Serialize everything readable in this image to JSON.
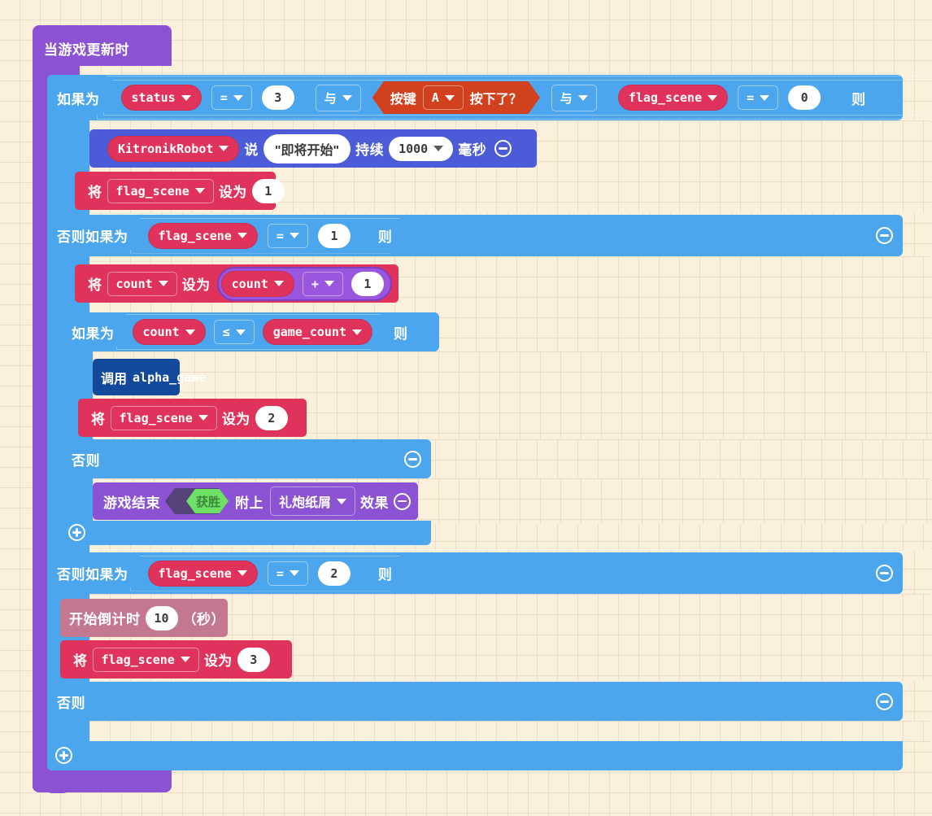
{
  "workspace": {
    "background_color": "#FBF0DC",
    "grid_color": "#C8B496"
  },
  "hat_block": {
    "label": "当游戏更新时",
    "color": "#8B52D4"
  },
  "blocks": {
    "if_keyword": "如果为",
    "else_if_keyword": "否则如果为",
    "else_keyword": "否则",
    "then_keyword": "则",
    "set_keyword": "将",
    "to_keyword": "设为",
    "control_color": "#4BA6EE",
    "variable_color": "#E0335B",
    "math_color": "#9B56E0",
    "input_color": "#D2411E",
    "robot_color": "#4C5CD8",
    "function_color": "#12499B",
    "game_color": "#8B52D4",
    "timer_color": "#C4788F"
  },
  "condition_1": {
    "var_a": "status",
    "op_a": "=",
    "val_a": "3",
    "logic_1": "与",
    "button_prefix": "按键",
    "button_name": "A",
    "button_suffix": "按下了？",
    "logic_2": "与",
    "var_b": "flag_scene",
    "op_b": "=",
    "val_b": "0"
  },
  "say_block": {
    "robot": "KitronikRobot",
    "say_label": "说",
    "message": "\"即将开始\"",
    "duration_label": "持续",
    "duration_value": "1000",
    "unit_label": "毫秒"
  },
  "set_flag_1": {
    "variable": "flag_scene",
    "value": "1"
  },
  "condition_2": {
    "variable": "flag_scene",
    "op": "=",
    "value": "1"
  },
  "set_count": {
    "variable": "count",
    "operand_a": "count",
    "operator": "+",
    "operand_b": "1"
  },
  "condition_3": {
    "var_a": "count",
    "op": "≤",
    "var_b": "game_count"
  },
  "call_block": {
    "call_label": "调用",
    "function_name": "alpha_game"
  },
  "set_flag_2": {
    "variable": "flag_scene",
    "value": "2"
  },
  "game_over_block": {
    "prefix": "游戏结束",
    "boolean_value": "获胜",
    "with_label": "附上",
    "effect_name": "礼炮纸屑",
    "effect_label": "效果"
  },
  "condition_4": {
    "variable": "flag_scene",
    "op": "=",
    "value": "2"
  },
  "countdown_block": {
    "label": "开始倒计时",
    "value": "10",
    "unit": "（秒）"
  },
  "set_flag_3": {
    "variable": "flag_scene",
    "value": "3"
  }
}
